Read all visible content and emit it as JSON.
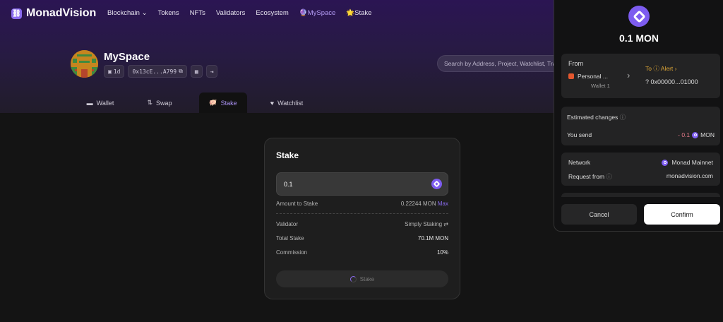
{
  "nav": {
    "brand": "MonadVision",
    "items": [
      "Blockchain",
      "Tokens",
      "NFTs",
      "Validators",
      "Ecosystem",
      "MySpace",
      "Stake"
    ]
  },
  "profile": {
    "title": "MySpace",
    "age": "1d",
    "address": "0x13cE...A799"
  },
  "search": {
    "placeholder": "Search by Address, Project, Watchlist, Tra"
  },
  "tabs": [
    "Wallet",
    "Swap",
    "Stake",
    "Watchlist"
  ],
  "stake": {
    "title": "Stake",
    "amount": "0.1",
    "amount_label": "Amount to Stake",
    "balance": "0.22244 MON",
    "max": "Max",
    "validator_label": "Validator",
    "validator": "Simply Staking",
    "total_label": "Total Stake",
    "total": "70.1M MON",
    "commission_label": "Commission",
    "commission": "10%",
    "button": "Stake"
  },
  "wallet": {
    "amount": "0.1 MON",
    "from_label": "From",
    "from_account": "Personal ...",
    "from_wallet": "Wallet 1",
    "to_label": "To",
    "alert": "Alert",
    "to_address": "0x00000...01000",
    "est_label": "Estimated changes",
    "send_label": "You send",
    "send_value": "- 0.1",
    "send_token": "MON",
    "network_label": "Network",
    "network": "Monad Mainnet",
    "request_label": "Request from",
    "request": "monadvision.com",
    "cancel": "Cancel",
    "confirm": "Confirm"
  },
  "colors": {
    "accent": "#8b6cf0",
    "alert": "#d9a336"
  }
}
